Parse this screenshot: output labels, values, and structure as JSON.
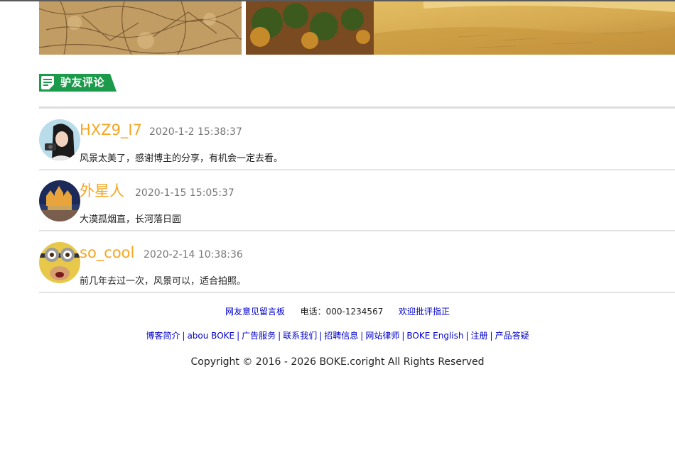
{
  "section": {
    "title": "驴友评论",
    "icon": "comment-doc-icon"
  },
  "comments": [
    {
      "name": "HXZ9_I7",
      "time": "2020-1-2 15:38:37",
      "text": "风景太美了，感谢博主的分享，有机会一定去看。",
      "avatar": "girl-with-camera-avatar"
    },
    {
      "name": "外星人",
      "time": "2020-1-15 15:05:37",
      "text": "大漠孤烟直，长河落日圆",
      "avatar": "castle-night-avatar"
    },
    {
      "name": "so_cool",
      "time": "2020-2-14 10:38:36",
      "text": "前几年去过一次，风景可以，适合拍照。",
      "avatar": "minion-avatar"
    }
  ],
  "footer": {
    "guestbook": "网友意见留言板",
    "phone": "电话：000-1234567",
    "feedback": "欢迎批评指正",
    "links": [
      "博客简介",
      "abou BOKE",
      "广告服务",
      "联系我们",
      "招聘信息",
      "网站律师",
      "BOKE English",
      "注册",
      "产品答疑"
    ],
    "copyright": "Copyright © 2016 - 2026 BOKE.coright All Rights Reserved"
  },
  "colors": {
    "accent_green": "#1a9a4a",
    "name_orange": "#f5a623",
    "link_blue": "#0000cc"
  }
}
